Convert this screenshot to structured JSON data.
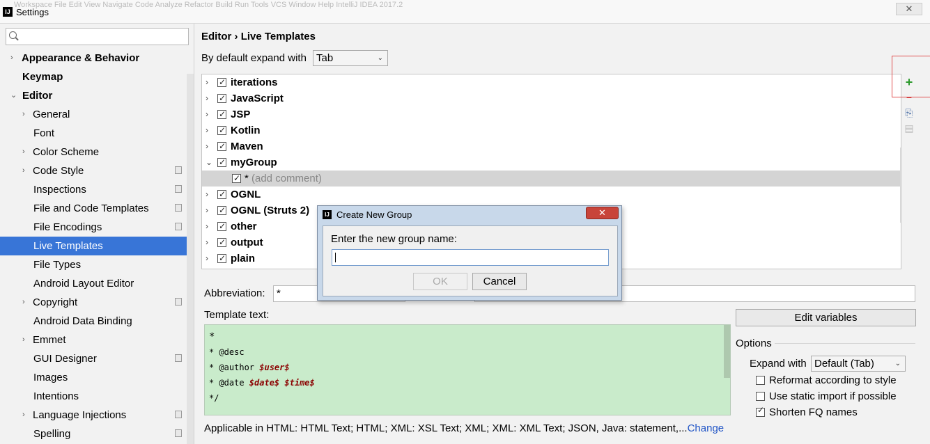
{
  "window": {
    "title": "Settings",
    "background_menu": "Workspace   File   Edit   View   Navigate   Code   Analyze   Refactor   Build   Run   Tools   VCS   Window   Help     IntelliJ IDEA 2017.2",
    "close_label": "✕"
  },
  "search": {
    "placeholder": ""
  },
  "sidebar": {
    "items": [
      {
        "label": "Appearance & Behavior",
        "arrow": "›"
      },
      {
        "label": "Keymap"
      },
      {
        "label": "Editor",
        "arrow": "⌄"
      },
      {
        "label": "General",
        "arrow": "›"
      },
      {
        "label": "Font"
      },
      {
        "label": "Color Scheme",
        "arrow": "›"
      },
      {
        "label": "Code Style",
        "arrow": "›"
      },
      {
        "label": "Inspections"
      },
      {
        "label": "File and Code Templates"
      },
      {
        "label": "File Encodings"
      },
      {
        "label": "Live Templates"
      },
      {
        "label": "File Types"
      },
      {
        "label": "Android Layout Editor"
      },
      {
        "label": "Copyright",
        "arrow": "›"
      },
      {
        "label": "Android Data Binding"
      },
      {
        "label": "Emmet",
        "arrow": "›"
      },
      {
        "label": "GUI Designer"
      },
      {
        "label": "Images"
      },
      {
        "label": "Intentions"
      },
      {
        "label": "Language Injections",
        "arrow": "›"
      },
      {
        "label": "Spelling"
      }
    ],
    "selected": "Live Templates"
  },
  "breadcrumb": {
    "parent": "Editor",
    "sep": "›",
    "current": "Live Templates"
  },
  "expand": {
    "label": "By default expand with",
    "value": "Tab"
  },
  "templates": {
    "groups": [
      {
        "name": "iterations"
      },
      {
        "name": "JavaScript"
      },
      {
        "name": "JSP"
      },
      {
        "name": "Kotlin"
      },
      {
        "name": "Maven"
      },
      {
        "name": "myGroup"
      },
      {
        "name": "*",
        "comment": "(add comment)"
      },
      {
        "name": "OGNL"
      },
      {
        "name": "OGNL (Struts 2)"
      },
      {
        "name": "other"
      },
      {
        "name": "output"
      },
      {
        "name": "plain"
      }
    ]
  },
  "toolbar": {
    "add": "+",
    "remove": "−",
    "copy": "⎘",
    "paste": "▤"
  },
  "abbreviation": {
    "label": "Abbreviation:",
    "value": "*"
  },
  "template_text": {
    "label": "Template text:",
    "lines": [
      [
        "*"
      ],
      [
        "* @desc"
      ],
      [
        "* @author ",
        "$user$"
      ],
      [
        "* @date ",
        "$date$",
        " ",
        "$time$"
      ],
      [
        "*/"
      ]
    ]
  },
  "edit_variables_label": "Edit variables",
  "options": {
    "label": "Options",
    "expand_label": "Expand with",
    "expand_value": "Default (Tab)",
    "reformat": "Reformat according to style",
    "static_import": "Use static import if possible",
    "shorten": "Shorten FQ names"
  },
  "applicable": {
    "text": "Applicable in HTML: HTML Text; HTML; XML: XSL Text; XML; XML: XML Text; JSON, Java: statement,...",
    "link": "Change"
  },
  "dialog": {
    "title": "Create New Group",
    "close": "✕",
    "prompt": "Enter the new group name:",
    "input_value": "",
    "ok": "OK",
    "cancel": "Cancel"
  },
  "colors": {
    "selection": "#3875d7",
    "template_bg": "#c9ebcb",
    "link": "#2155c6",
    "add_green": "#2d9a2d"
  }
}
